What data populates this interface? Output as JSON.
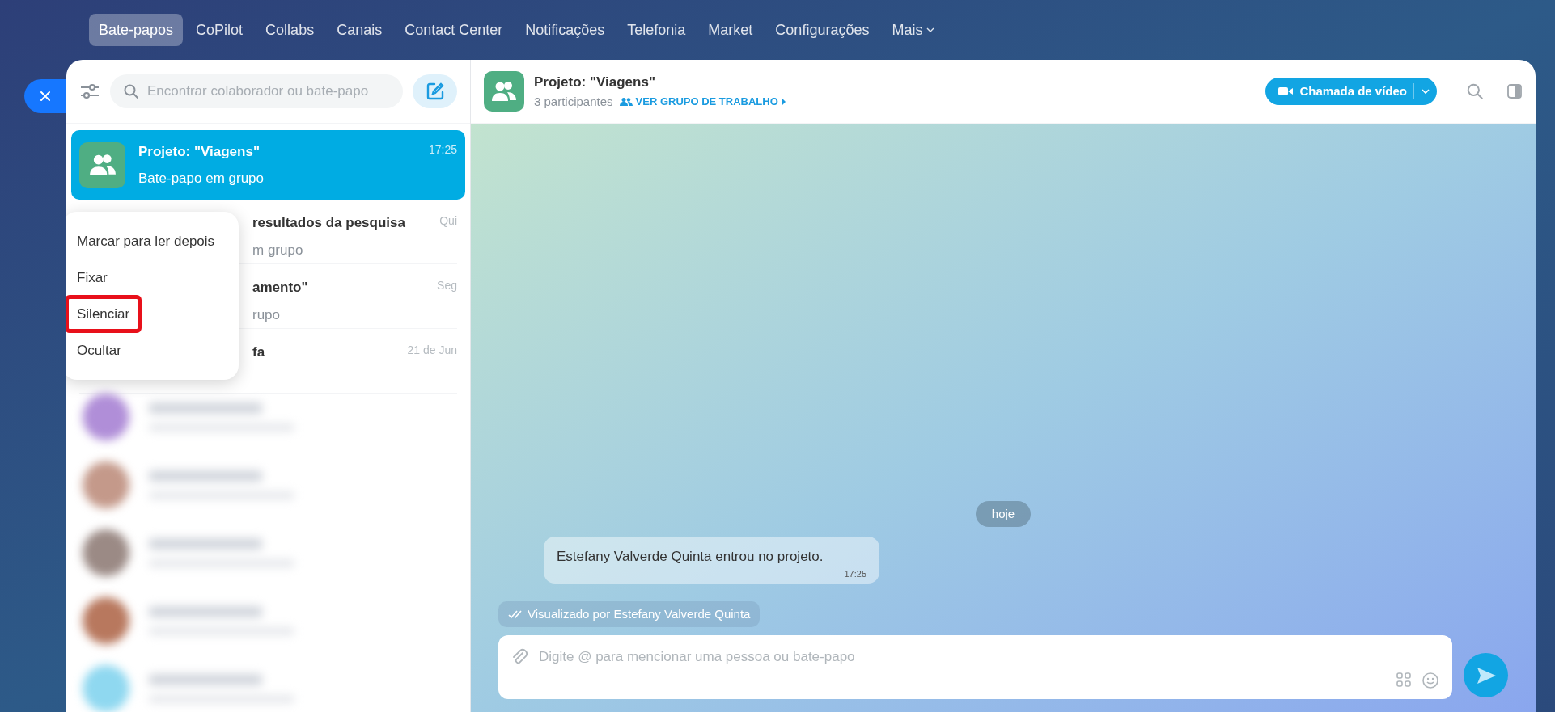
{
  "nav": [
    {
      "label": "Bate-papos",
      "selected": true,
      "kind": "link"
    },
    {
      "label": "CoPilot",
      "selected": false,
      "kind": "link"
    },
    {
      "label": "Collabs",
      "selected": false,
      "kind": "link"
    },
    {
      "label": "Canais",
      "selected": false,
      "kind": "link"
    },
    {
      "label": "Contact Center",
      "selected": false,
      "kind": "link"
    },
    {
      "label": "Notificações",
      "selected": false,
      "kind": "link"
    },
    {
      "label": "Telefonia",
      "selected": false,
      "kind": "link"
    },
    {
      "label": "Market",
      "selected": false,
      "kind": "link"
    },
    {
      "label": "Configurações",
      "selected": false,
      "kind": "link"
    },
    {
      "label": "Mais",
      "selected": false,
      "kind": "dropdown"
    }
  ],
  "sidebar": {
    "search_placeholder": "Encontrar colaborador ou bate-papo",
    "chats": [
      {
        "title": "Projeto: \"Viagens\"",
        "subtitle": "Bate-papo em grupo",
        "time": "17:25",
        "selected": true
      },
      {
        "title": "resultados da pesquisa",
        "subtitle": "m grupo",
        "time": "Qui",
        "selected": false
      },
      {
        "title": "amento\"",
        "subtitle": "rupo",
        "time": "Seg",
        "selected": false
      },
      {
        "title": "fa",
        "time": "21 de Jun",
        "selected": false
      }
    ],
    "blurred_chats": [
      {
        "color": "#b08ed8"
      },
      {
        "color": "#c4998a"
      },
      {
        "color": "#9b8a85"
      },
      {
        "color": "#b8785e"
      },
      {
        "color": "#8fd8f0"
      }
    ]
  },
  "context_menu": [
    {
      "label": "Marcar para ler depois",
      "highlighted": false
    },
    {
      "label": "Fixar",
      "highlighted": false
    },
    {
      "label": "Silenciar",
      "highlighted": true
    },
    {
      "label": "Ocultar",
      "highlighted": false
    }
  ],
  "chat": {
    "title": "Projeto: \"Viagens\"",
    "participants": "3 participantes",
    "group_link": "VER GRUPO DE TRABALHO",
    "call_button": "Chamada de vídeo",
    "date": "hoje",
    "message": {
      "text": "Estefany Valverde Quinta entrou no projeto.",
      "time": "17:25"
    },
    "seen": "Visualizado por Estefany Valverde Quinta",
    "input_placeholder": "Digite @ para mencionar uma pessoa ou bate-papo"
  }
}
